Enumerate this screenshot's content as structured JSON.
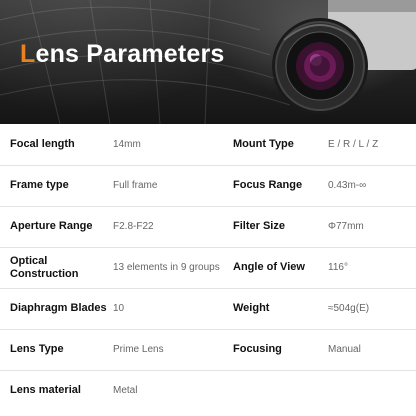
{
  "header": {
    "title_first_letter": "L",
    "title_rest": "ens Parameters",
    "accent_color": "#e8821e"
  },
  "specs": [
    {
      "label_left": "Focal length",
      "value_left": "14mm",
      "label_right": "Mount Type",
      "value_right": "E / R / L / Z"
    },
    {
      "label_left": "Frame type",
      "value_left": "Full frame",
      "label_right": "Focus Range",
      "value_right": "0.43m-∞"
    },
    {
      "label_left": "Aperture Range",
      "value_left": "F2.8-F22",
      "label_right": "Filter Size",
      "value_right": "Φ77mm"
    },
    {
      "label_left": "Optical Construction",
      "value_left": "13 elements in 9 groups",
      "label_right": "Angle of View",
      "value_right": "116°"
    },
    {
      "label_left": "Diaphragm Blades",
      "value_left": "10",
      "label_right": "Weight",
      "value_right": "≈504g(E)"
    },
    {
      "label_left": "Lens Type",
      "value_left": "Prime Lens",
      "label_right": "Focusing",
      "value_right": "Manual"
    },
    {
      "label_left": "Lens material",
      "value_left": "Metal",
      "label_right": "",
      "value_right": ""
    }
  ]
}
